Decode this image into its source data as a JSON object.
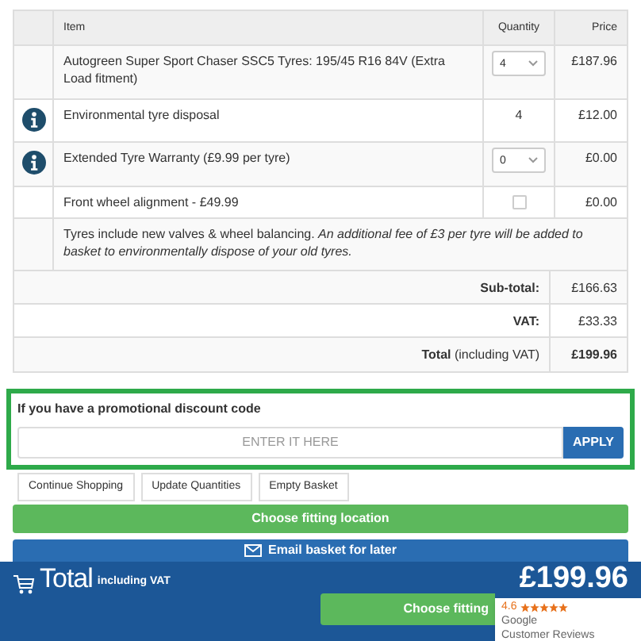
{
  "basket_table": {
    "columns": [
      "Item",
      "Quantity",
      "Price"
    ],
    "rows": [
      {
        "kind": "select",
        "info": false,
        "item": "Autogreen Super Sport Chaser SSC5 Tyres: 195/45 R16 84V (Extra Load fitment)",
        "quantity": "4",
        "price": "£187.96"
      },
      {
        "kind": "text",
        "info": true,
        "item": "Environmental tyre disposal",
        "quantity": "4",
        "price": "£12.00"
      },
      {
        "kind": "select",
        "info": true,
        "item": "Extended Tyre Warranty (£9.99 per tyre)",
        "quantity": "0",
        "price": "£0.00"
      },
      {
        "kind": "checkbox",
        "info": false,
        "item": "Front wheel alignment - £49.99",
        "checked": false,
        "price": "£0.00"
      }
    ],
    "note": "Tyres include new valves & wheel balancing. *An additional fee of £3 per tyre will be added to basket to environmentally dispose of your old tyres.*",
    "totals": [
      {
        "label": "**Sub-total:**",
        "value": "£166.63",
        "bold": false
      },
      {
        "label": "**VAT:**",
        "value": "£33.33",
        "bold": false
      },
      {
        "label": "**Total** (including VAT)",
        "value": "£199.96",
        "bold": true
      }
    ]
  },
  "promo": {
    "title": "If you have a promotional discount code",
    "placeholder": "ENTER IT HERE",
    "apply": "APPLY"
  },
  "actions": [
    "Continue Shopping",
    "Update Quantities",
    "Empty Basket"
  ],
  "choose_fitting": "Choose fitting location",
  "email": "Email basket for later",
  "footer": {
    "total": "Total",
    "including": "including VAT",
    "amount": "£199.96",
    "button": "Choose fitting"
  },
  "reviews_badge": {
    "rating": "4.6",
    "stars": 5,
    "line1": "Google",
    "line2": "Customer Reviews"
  }
}
